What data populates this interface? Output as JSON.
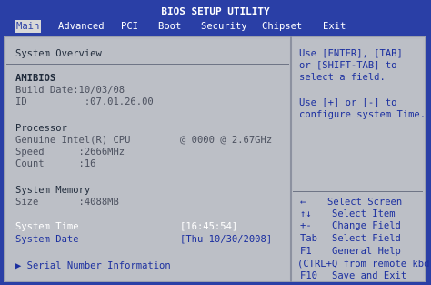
{
  "title": "BIOS SETUP UTILITY",
  "menu": [
    {
      "label": "Main"
    },
    {
      "label": "Advanced"
    },
    {
      "label": "PCI"
    },
    {
      "label": "Boot"
    },
    {
      "label": "Security"
    },
    {
      "label": "Chipset"
    },
    {
      "label": "Exit"
    }
  ],
  "main": {
    "heading": "System Overview",
    "bios_label": "AMIBIOS",
    "build_date": "Build Date:10/03/08",
    "id": "ID          :07.01.26.00",
    "processor_label": "Processor",
    "cpu_name": "Genuine Intel(R) CPU",
    "cpu_clock": "@ 0000 @ 2.67GHz",
    "speed": "Speed      :2666MHz",
    "count": "Count      :16",
    "memory_label": "System Memory",
    "size": "Size       :4088MB",
    "system_time_label": "System Time",
    "system_time_value": "[16:45:54]",
    "system_date_label": "System Date",
    "system_date_value": "[Thu 10/30/2008]",
    "serial_label": "▶ Serial Number Information"
  },
  "help": {
    "line1": "Use [ENTER], [TAB]",
    "line2": "or [SHIFT-TAB] to",
    "line3": "select a field.",
    "line4": "Use [+] or [-] to",
    "line5": "configure system Time."
  },
  "keys": [
    {
      "key": "←",
      "desc": "Select Screen"
    },
    {
      "key": "↑↓",
      "desc": "Select Item"
    },
    {
      "key": "+-",
      "desc": "Change Field"
    },
    {
      "key": "Tab",
      "desc": "Select Field"
    },
    {
      "key": "F1",
      "desc": "General Help"
    },
    {
      "key": "(CTRL+Q from remote kbd)",
      "desc": ""
    },
    {
      "key": "F10",
      "desc": "Save and Exit"
    }
  ]
}
